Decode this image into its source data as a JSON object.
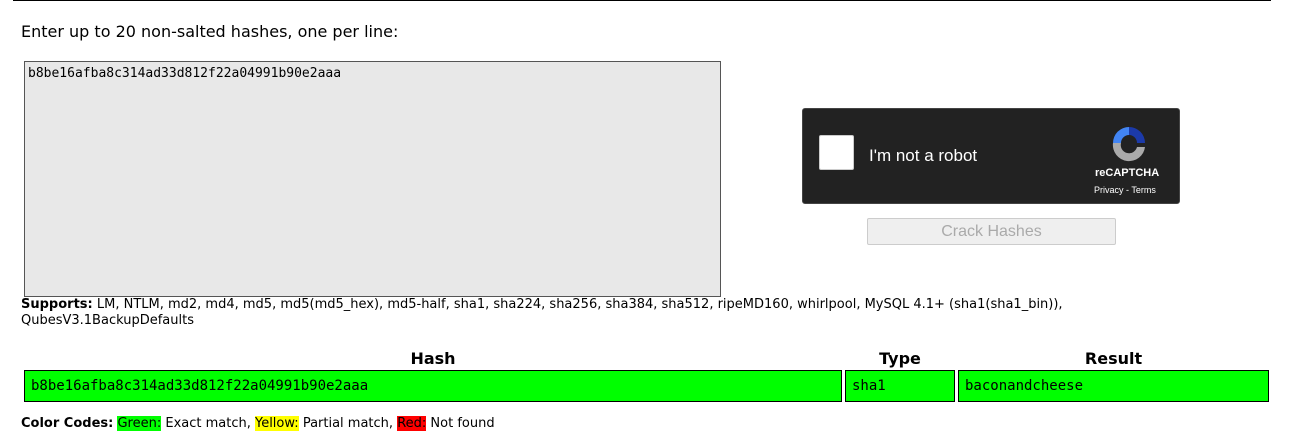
{
  "prompt": "Enter up to 20 non-salted hashes, one per line:",
  "hash_input": "b8be16afba8c314ad33d812f22a04991b90e2aaa",
  "captcha": {
    "label": "I'm not a robot",
    "brand": "reCAPTCHA",
    "links": "Privacy - Terms"
  },
  "crack_button": "Crack Hashes",
  "supports": {
    "label": "Supports:",
    "text": " LM, NTLM, md2, md4, md5, md5(md5_hex), md5-half, sha1, sha224, sha256, sha384, sha512, ripeMD160, whirlpool, MySQL 4.1+ (sha1(sha1_bin)), QubesV3.1BackupDefaults"
  },
  "results": {
    "headers": [
      "Hash",
      "Type",
      "Result"
    ],
    "rows": [
      {
        "hash": "b8be16afba8c314ad33d812f22a04991b90e2aaa",
        "type": "sha1",
        "result": "baconandcheese",
        "status_color": "#00ff00"
      }
    ]
  },
  "color_codes": {
    "label": "Color Codes:",
    "green": "Green:",
    "green_desc": " Exact match, ",
    "yellow": "Yellow:",
    "yellow_desc": " Partial match, ",
    "red": "Red:",
    "red_desc": " Not found"
  }
}
